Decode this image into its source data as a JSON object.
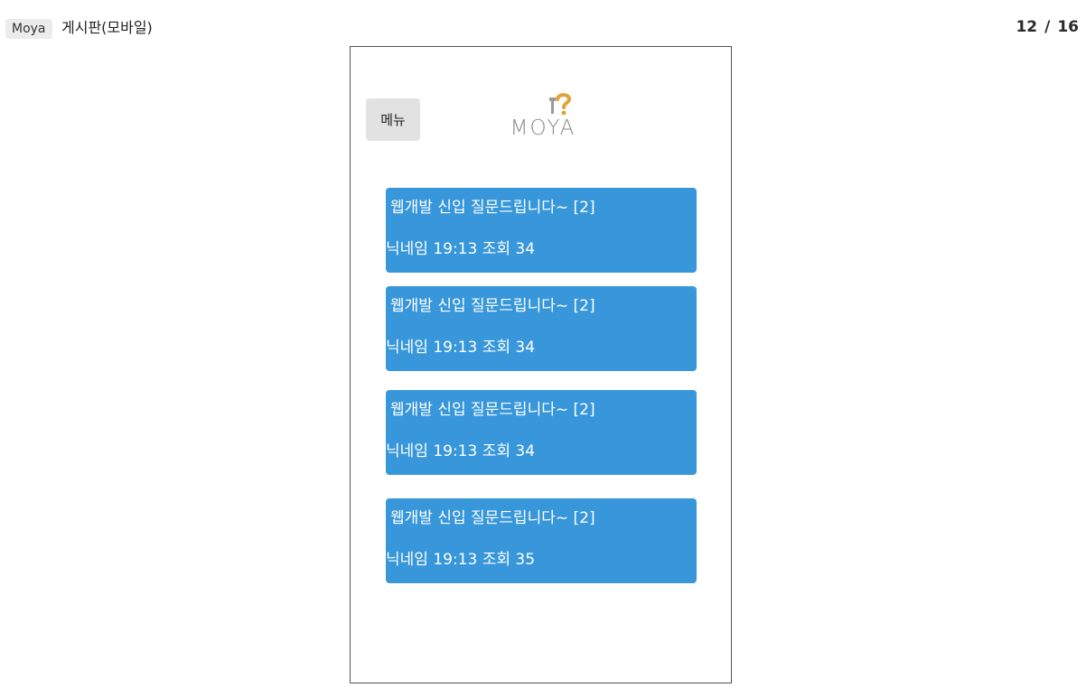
{
  "header": {
    "app_name": "Moya",
    "title": "게시판(모바일)",
    "page_current": "12",
    "page_separator": "/",
    "page_total": "16"
  },
  "phone": {
    "menu_label": "메뉴",
    "logo_text": "MOYA",
    "posts": [
      {
        "title": "웹개발 신입 질문드립니다~ [2]",
        "meta": "닉네임 19:13 조회 34"
      },
      {
        "title": "웹개발 신입 질문드립니다~ [2]",
        "meta": "닉네임 19:13 조회 34"
      },
      {
        "title": "웹개발 신입 질문드립니다~ [2]",
        "meta": "닉네임 19:13 조회 34"
      },
      {
        "title": "웹개발 신입 질문드립니다~ [2]",
        "meta": "닉네임 19:13 조회 35"
      }
    ]
  },
  "colors": {
    "card_background": "#3897da",
    "card_text": "#ffffff",
    "menu_button_background": "#e2e2e2",
    "logo_mark": "#e0a33a"
  }
}
